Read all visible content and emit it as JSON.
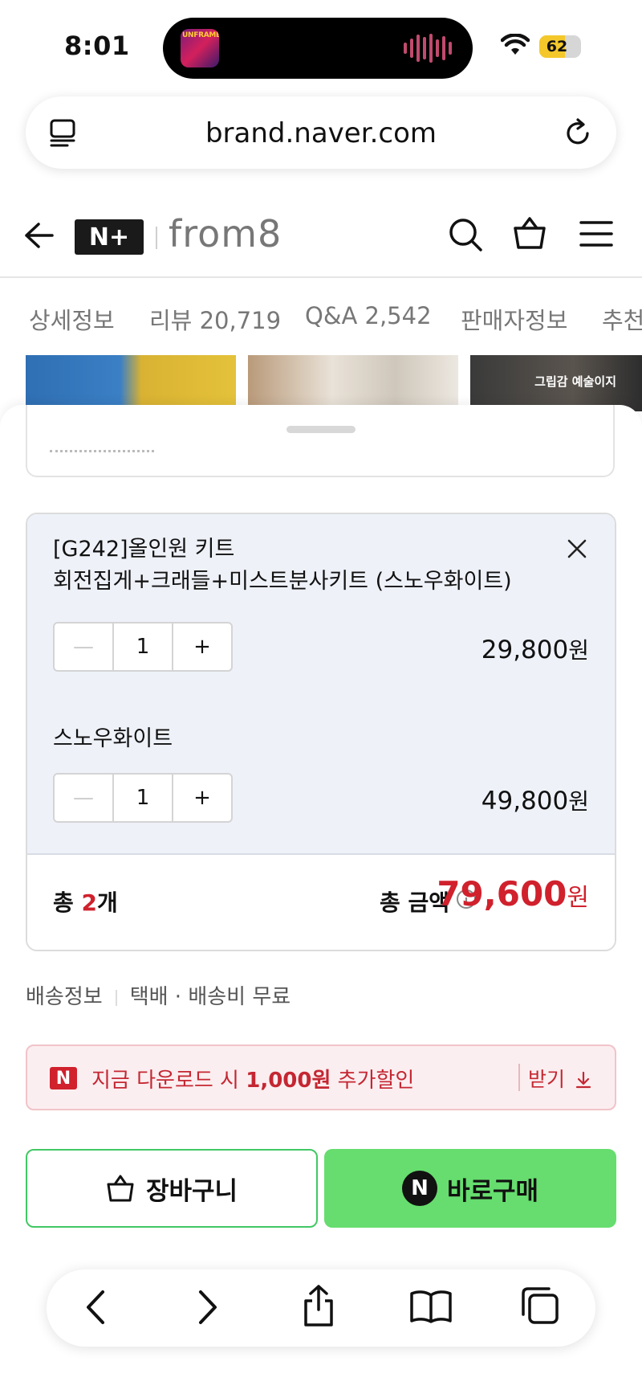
{
  "status_bar": {
    "time": "8:01",
    "now_playing_album_text": "UNFRAMED",
    "battery": "62",
    "battery_level": 0.62
  },
  "browser": {
    "url": "brand.naver.com",
    "left_icon": "tabs-list-icon",
    "right_icon": "reload-icon"
  },
  "site_header": {
    "logo": "N+",
    "brand": "from8",
    "icons": [
      "back-icon",
      "search-icon",
      "shopping-bag-icon",
      "menu-icon"
    ]
  },
  "tabs": [
    {
      "label": "상세정보"
    },
    {
      "label": "리뷰 20,719"
    },
    {
      "label": "Q&A 2,542"
    },
    {
      "label": "판매자정보"
    },
    {
      "label": "추천"
    }
  ],
  "thumbnail_caption": "그립감 예술이지",
  "options": [
    {
      "name_line1": "[G242]올인원 키트",
      "name_line2": "회전집게+크래들+미스트분사키트 (스노우화이트)",
      "quantity": "1",
      "price": "29,800",
      "won": "원",
      "removable": true
    },
    {
      "name_line1": "스노우화이트",
      "quantity": "1",
      "price": "49,800",
      "won": "원"
    }
  ],
  "total": {
    "count_prefix": "총 ",
    "count": "2",
    "count_suffix": "개",
    "label": "총 금액",
    "amount": "79,600",
    "won": "원"
  },
  "shipping": {
    "label": "배송정보",
    "value": "택배 · 배송비 무료"
  },
  "coupon": {
    "mark": "N",
    "text_prefix": "지금 다운로드 시 ",
    "text_bold": "1,000원",
    "text_suffix": " 추가할인",
    "action": "받기"
  },
  "buttons": {
    "cart": "장바구니",
    "buy_mark": "N",
    "buy": "바로구매"
  },
  "colors": {
    "accent_red": "#d0212d",
    "buy_green": "#66dd6e",
    "cart_border_green": "#42c864",
    "option_bg": "#eef1f8"
  },
  "safari_toolbar": [
    "back-icon",
    "forward-icon",
    "share-icon",
    "bookmarks-icon",
    "tabs-icon"
  ]
}
